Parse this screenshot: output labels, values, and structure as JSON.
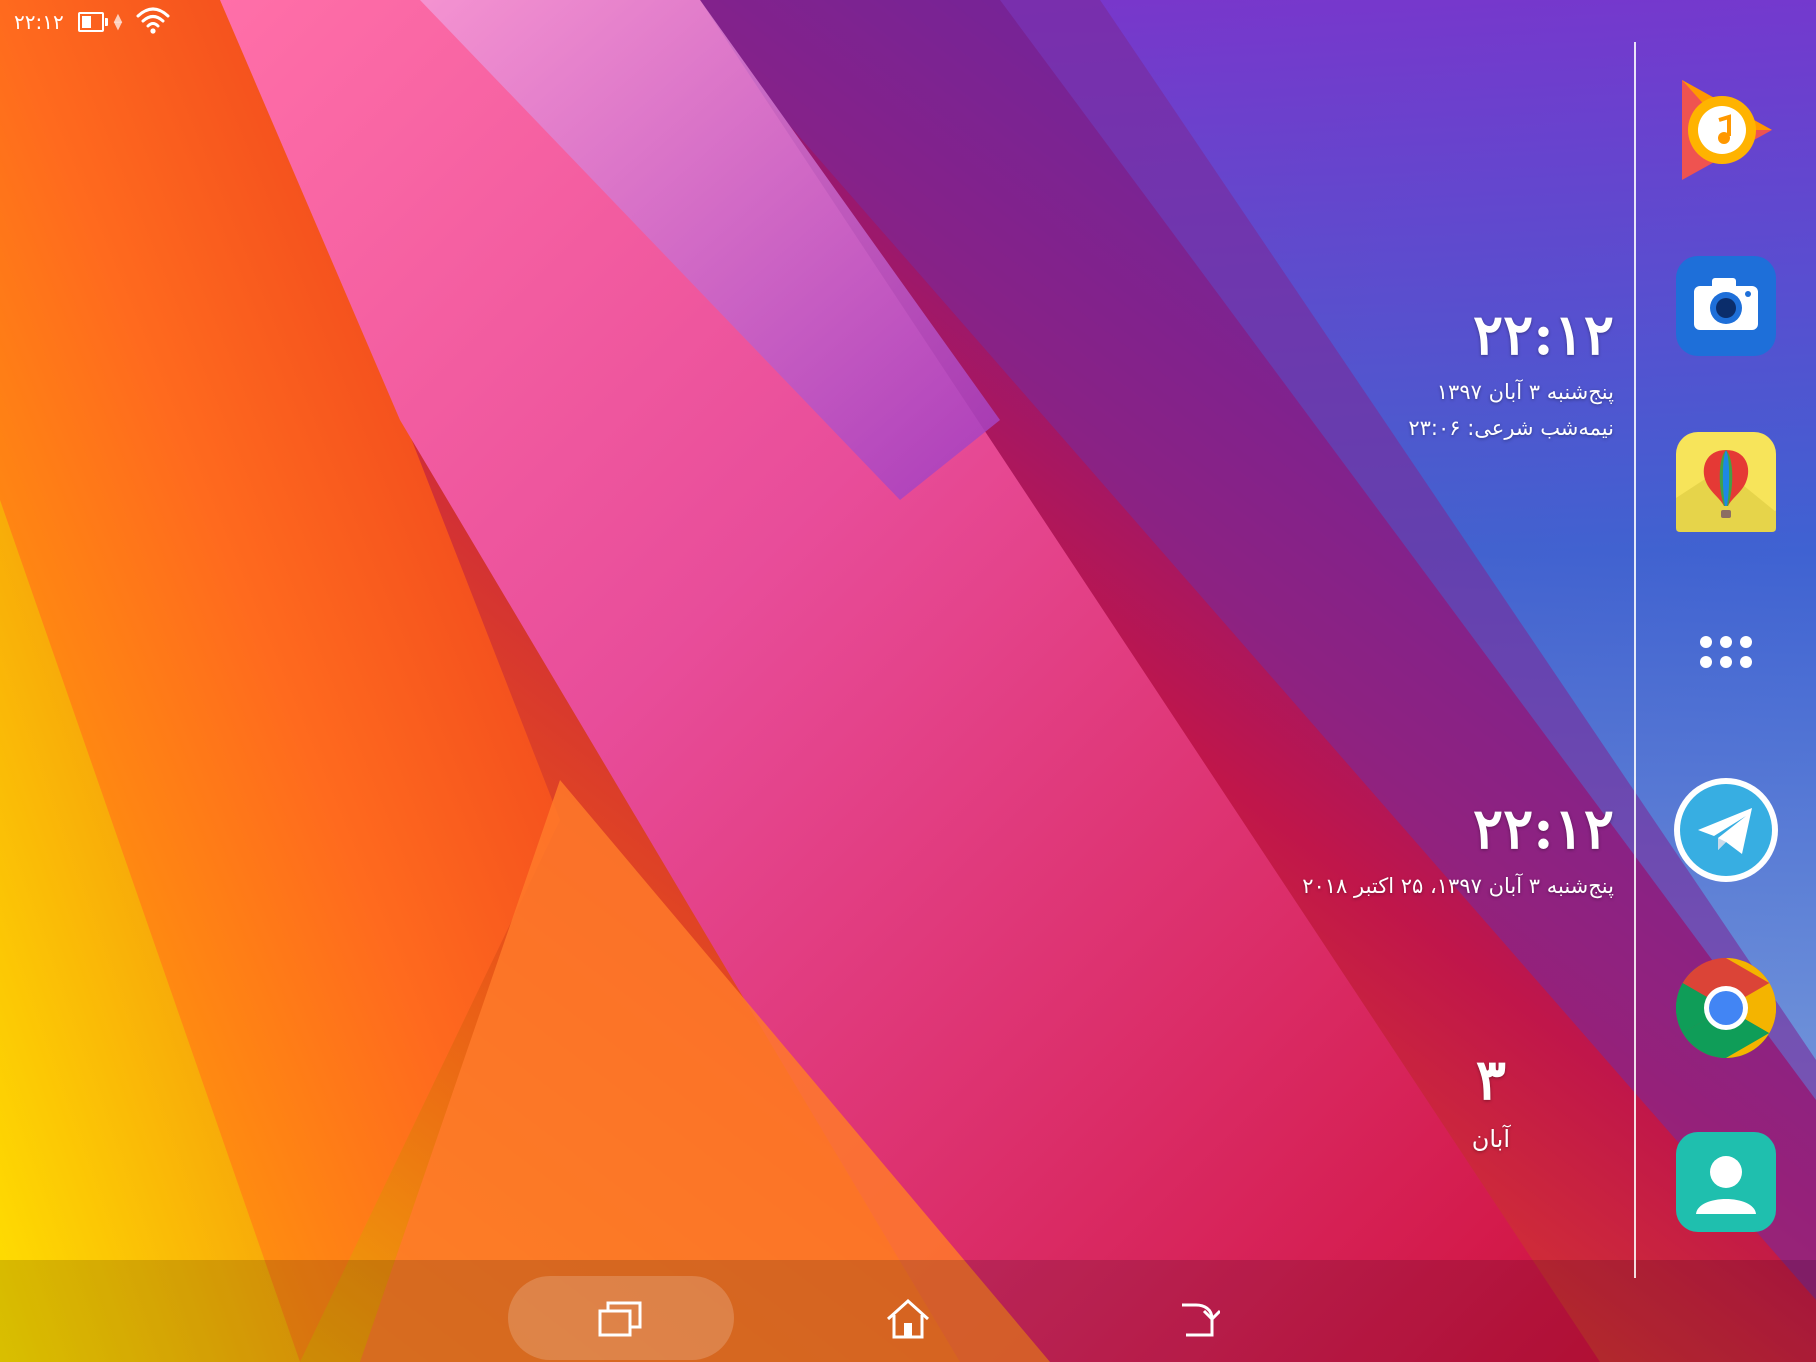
{
  "status_bar": {
    "time": "۲۲:۱۲",
    "battery_icon": "battery-icon",
    "wifi_icon": "wifi-icon"
  },
  "clock_widget_1": {
    "time": "۲۲:۱۲",
    "date": "پنج‌شنبه ۳ آبان ۱۳۹۷",
    "midnight": "نیمه‌شب شرعی: ۲۳:۰۶"
  },
  "clock_widget_2": {
    "time": "۲۲:۱۲",
    "date": "پنج‌شنبه ۳ آبان ۱۳۹۷، ۲۵ اکتبر ۲۰۱۸"
  },
  "calendar_widget": {
    "day": "۳",
    "month": "آبان"
  },
  "dock": {
    "apps": [
      {
        "name": "play-music-icon"
      },
      {
        "name": "camera-icon"
      },
      {
        "name": "hot-air-balloon-app-icon"
      },
      {
        "name": "app-drawer-icon"
      },
      {
        "name": "telegram-icon"
      },
      {
        "name": "chrome-icon"
      },
      {
        "name": "contacts-icon"
      }
    ]
  },
  "nav_bar": {
    "recent": "recent-apps-icon",
    "home": "home-icon",
    "back": "back-icon"
  },
  "colors": {
    "play_music_orange": "#ff9800",
    "camera_blue": "#1e6fd9",
    "telegram_blue": "#37aee2",
    "contacts_teal": "#1fbfae",
    "chrome_red": "#db4437",
    "chrome_green": "#0f9d58",
    "chrome_yellow": "#f4b400"
  }
}
